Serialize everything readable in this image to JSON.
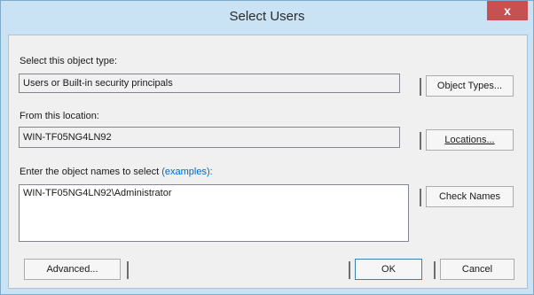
{
  "window": {
    "title": "Select Users",
    "close_label": "x"
  },
  "object_type": {
    "label": "Select this object type:",
    "value": "Users or Built-in security principals",
    "button_label": "Object Types..."
  },
  "location": {
    "label": "From this location:",
    "value": "WIN-TF05NG4LN92",
    "button_label": "Locations..."
  },
  "names": {
    "label": "Enter the object names to select",
    "examples_link": "(examples):",
    "value": "WIN-TF05NG4LN92\\Administrator",
    "button_label": "Check Names"
  },
  "footer": {
    "advanced_label": "Advanced...",
    "ok_label": "OK",
    "cancel_label": "Cancel"
  },
  "colors": {
    "title_bar": "#c9e3f4",
    "close_button": "#c75050",
    "link": "#0066cc"
  }
}
